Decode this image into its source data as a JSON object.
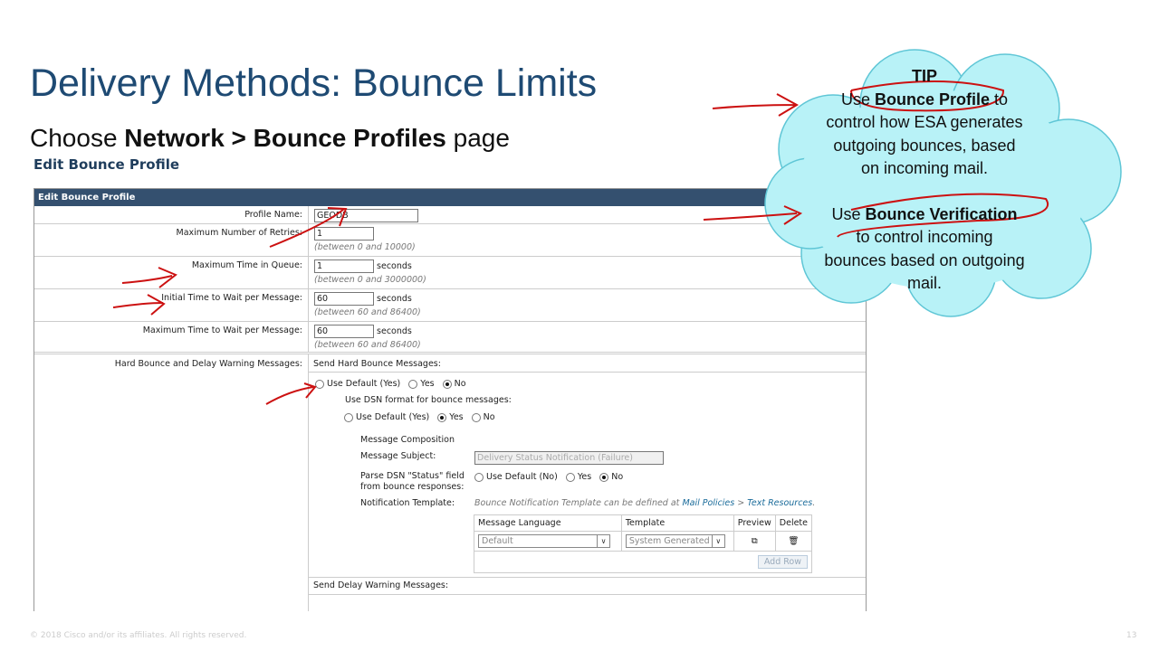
{
  "slide": {
    "title": "Delivery Methods: Bounce Limits",
    "subtitle_prefix": "Choose ",
    "subtitle_bold": "Network > Bounce Profiles",
    "subtitle_suffix": " page",
    "footer": "© 2018 Cisco and/or its affiliates. All rights reserved.",
    "page_number": "13"
  },
  "page": {
    "heading": "Edit Bounce Profile",
    "panel_header": "Edit Bounce Profile",
    "fields": [
      {
        "label": "Profile Name:",
        "value": "GEODB",
        "unit": "",
        "hint": ""
      },
      {
        "label": "Maximum Number of Retries:",
        "value": "1",
        "unit": "",
        "hint": "(between 0 and 10000)"
      },
      {
        "label": "Maximum Time in Queue:",
        "value": "1",
        "unit": "seconds",
        "hint": "(between 0 and 3000000)"
      },
      {
        "label": "Initial Time to Wait per Message:",
        "value": "60",
        "unit": "seconds",
        "hint": "(between 60 and 86400)"
      },
      {
        "label": "Maximum Time to Wait per Message:",
        "value": "60",
        "unit": "seconds",
        "hint": "(between 60 and 86400)"
      }
    ],
    "hard_bounce": {
      "label": "Hard Bounce and Delay Warning Messages:",
      "send_hard": "Send Hard Bounce Messages:",
      "send_options": [
        "Use Default (Yes)",
        "Yes",
        "No"
      ],
      "send_selected": "No",
      "dsn_label": "Use DSN format for bounce messages:",
      "dsn_options": [
        "Use Default (Yes)",
        "Yes",
        "No"
      ],
      "dsn_selected": "Yes",
      "composition": "Message Composition",
      "subject_label": "Message Subject:",
      "subject_value": "Delivery Status Notification (Failure)",
      "parse_label1": "Parse DSN \"Status\" field",
      "parse_label2": "from bounce responses:",
      "parse_options": [
        "Use Default (No)",
        "Yes",
        "No"
      ],
      "parse_selected": "No",
      "template_label": "Notification Template:",
      "template_note": "Bounce Notification Template can be defined at ",
      "template_link1": "Mail Policies",
      "template_sep": " > ",
      "template_link2": "Text Resources",
      "template_end": ".",
      "table_headers": [
        "Message Language",
        "Template",
        "Preview",
        "Delete"
      ],
      "language": "Default",
      "template": "System Generated",
      "add_row": "Add Row",
      "send_delay": "Send Delay Warning Messages:"
    }
  },
  "tip": {
    "heading": "TIP",
    "line1_pre": "Use ",
    "line1_bold": "Bounce Profile",
    "line1_post": " to",
    "line2": "control how ESA generates",
    "line3": "outgoing bounces, based",
    "line4": "on incoming mail.",
    "line5_pre": "Use ",
    "line5_bold": "Bounce Verification",
    "line6": "to control incoming",
    "line7": "bounces based on outgoing",
    "line8": "mail."
  },
  "colors": {
    "title": "#1e4a73",
    "panel_header": "#34506f",
    "cloud": "#b8f2f7",
    "annotation": "#cc1111"
  }
}
